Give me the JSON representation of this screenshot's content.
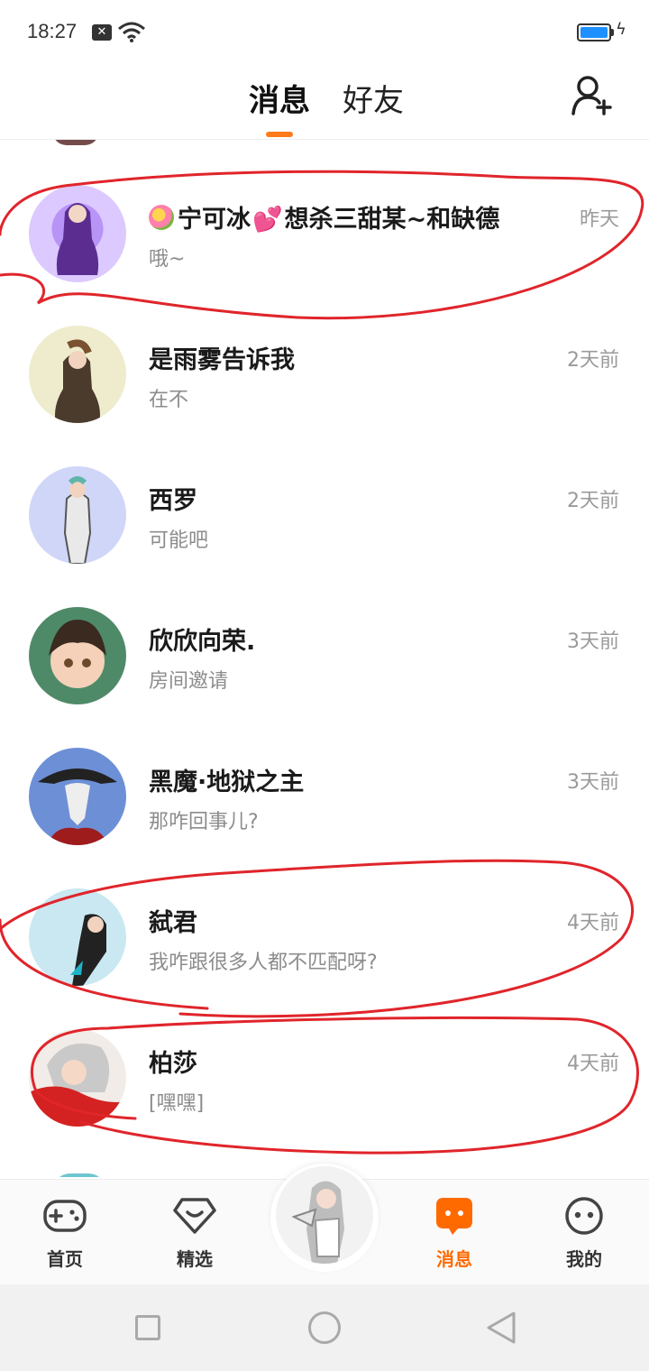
{
  "status_bar": {
    "time": "18:27"
  },
  "header": {
    "tabs": [
      "消息",
      "好友"
    ],
    "active_tab": "消息"
  },
  "conversations": [
    {
      "name_pre": "",
      "name_mid": "宁可冰",
      "name_post": "想杀三甜某~和缺德",
      "preview": "哦~",
      "time": "昨天"
    },
    {
      "name": "是雨雾告诉我",
      "preview": "在不",
      "time": "2天前"
    },
    {
      "name": "西罗",
      "preview": "可能吧",
      "time": "2天前"
    },
    {
      "name": "欣欣向荣.",
      "preview": "房间邀请",
      "time": "3天前"
    },
    {
      "name": "黑魔·地狱之主",
      "preview": "那咋回事儿?",
      "time": "3天前"
    },
    {
      "name": "弑君",
      "preview": "我咋跟很多人都不匹配呀?",
      "time": "4天前"
    },
    {
      "name": "柏莎",
      "preview": "[嘿嘿]",
      "time": "4天前"
    }
  ],
  "bottom_nav": {
    "items": [
      {
        "label": "首页"
      },
      {
        "label": "精选"
      },
      {
        "label": "消息"
      },
      {
        "label": "我的"
      }
    ],
    "active": "消息"
  },
  "colors": {
    "accent": "#ff6a00",
    "annotation": "#e0252b"
  }
}
